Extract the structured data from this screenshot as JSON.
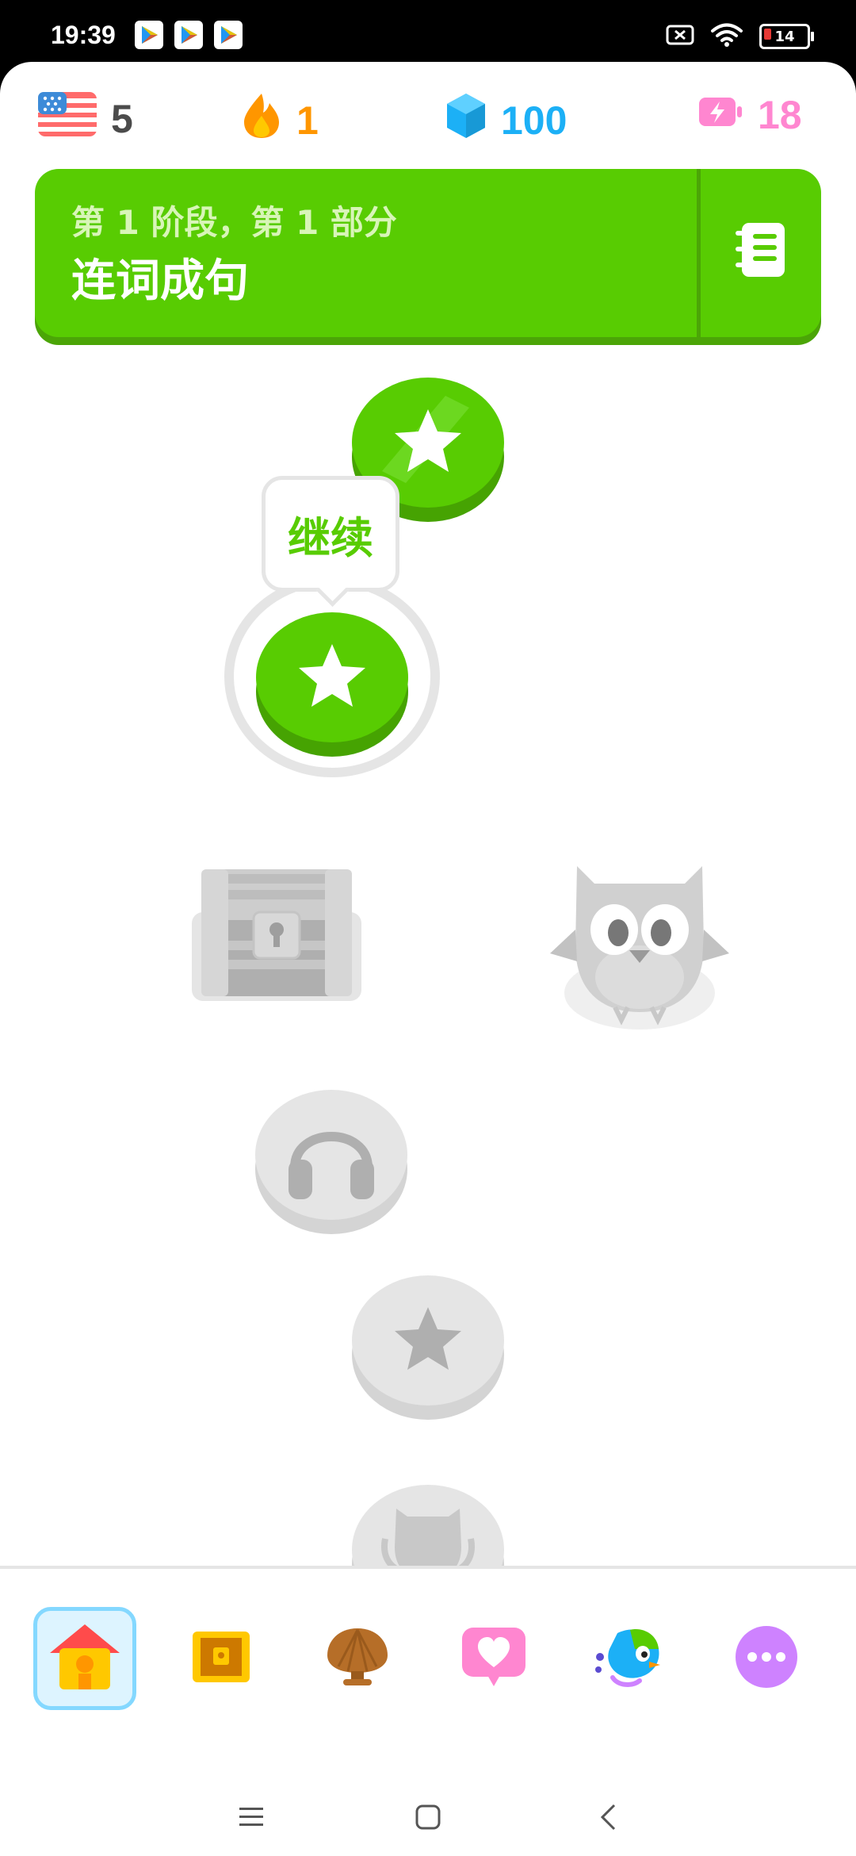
{
  "status_bar": {
    "time": "19:39",
    "battery_level": "14",
    "notification_icons": [
      "play-store-icon",
      "play-store-icon",
      "play-store-icon"
    ],
    "system_icons": [
      "sim-card-off-icon",
      "wifi-icon",
      "battery-icon"
    ]
  },
  "top_stats": {
    "language_flag": "us-flag-icon",
    "language_count": "5",
    "streak": "1",
    "gems": "100",
    "energy": "18",
    "colors": {
      "count": "#4b4b4b",
      "streak": "#ff9600",
      "gems": "#1cb0f6",
      "energy": "#ff86d0"
    }
  },
  "unit": {
    "subtitle": "第 1 阶段，第 1 部分",
    "title": "连词成句",
    "guide_icon": "guidebook-icon",
    "color": "#58cc02"
  },
  "path": {
    "tooltip_label": "继续",
    "nodes": [
      {
        "name": "lesson-1",
        "icon": "star-icon",
        "state": "completed"
      },
      {
        "name": "lesson-2",
        "icon": "star-icon",
        "state": "current"
      },
      {
        "name": "treasure-chest",
        "icon": "chest-icon",
        "state": "locked"
      },
      {
        "name": "duo-mascot",
        "icon": "owl-icon",
        "state": "locked"
      },
      {
        "name": "listening-lesson",
        "icon": "headphones-icon",
        "state": "locked"
      },
      {
        "name": "lesson-5",
        "icon": "star-icon",
        "state": "locked"
      },
      {
        "name": "unit-review",
        "icon": "trophy-icon",
        "state": "locked"
      }
    ]
  },
  "tab_bar": {
    "tabs": [
      {
        "name": "learn",
        "icon": "home-icon",
        "active": true
      },
      {
        "name": "practice",
        "icon": "practice-chest-icon",
        "active": false
      },
      {
        "name": "leaderboard",
        "icon": "shell-trophy-icon",
        "active": false
      },
      {
        "name": "friends",
        "icon": "heart-icon",
        "active": false
      },
      {
        "name": "super",
        "icon": "super-duo-icon",
        "active": false
      },
      {
        "name": "more",
        "icon": "more-icon",
        "active": false
      }
    ]
  },
  "system_nav": [
    "menu-icon",
    "home-square-icon",
    "back-icon"
  ]
}
